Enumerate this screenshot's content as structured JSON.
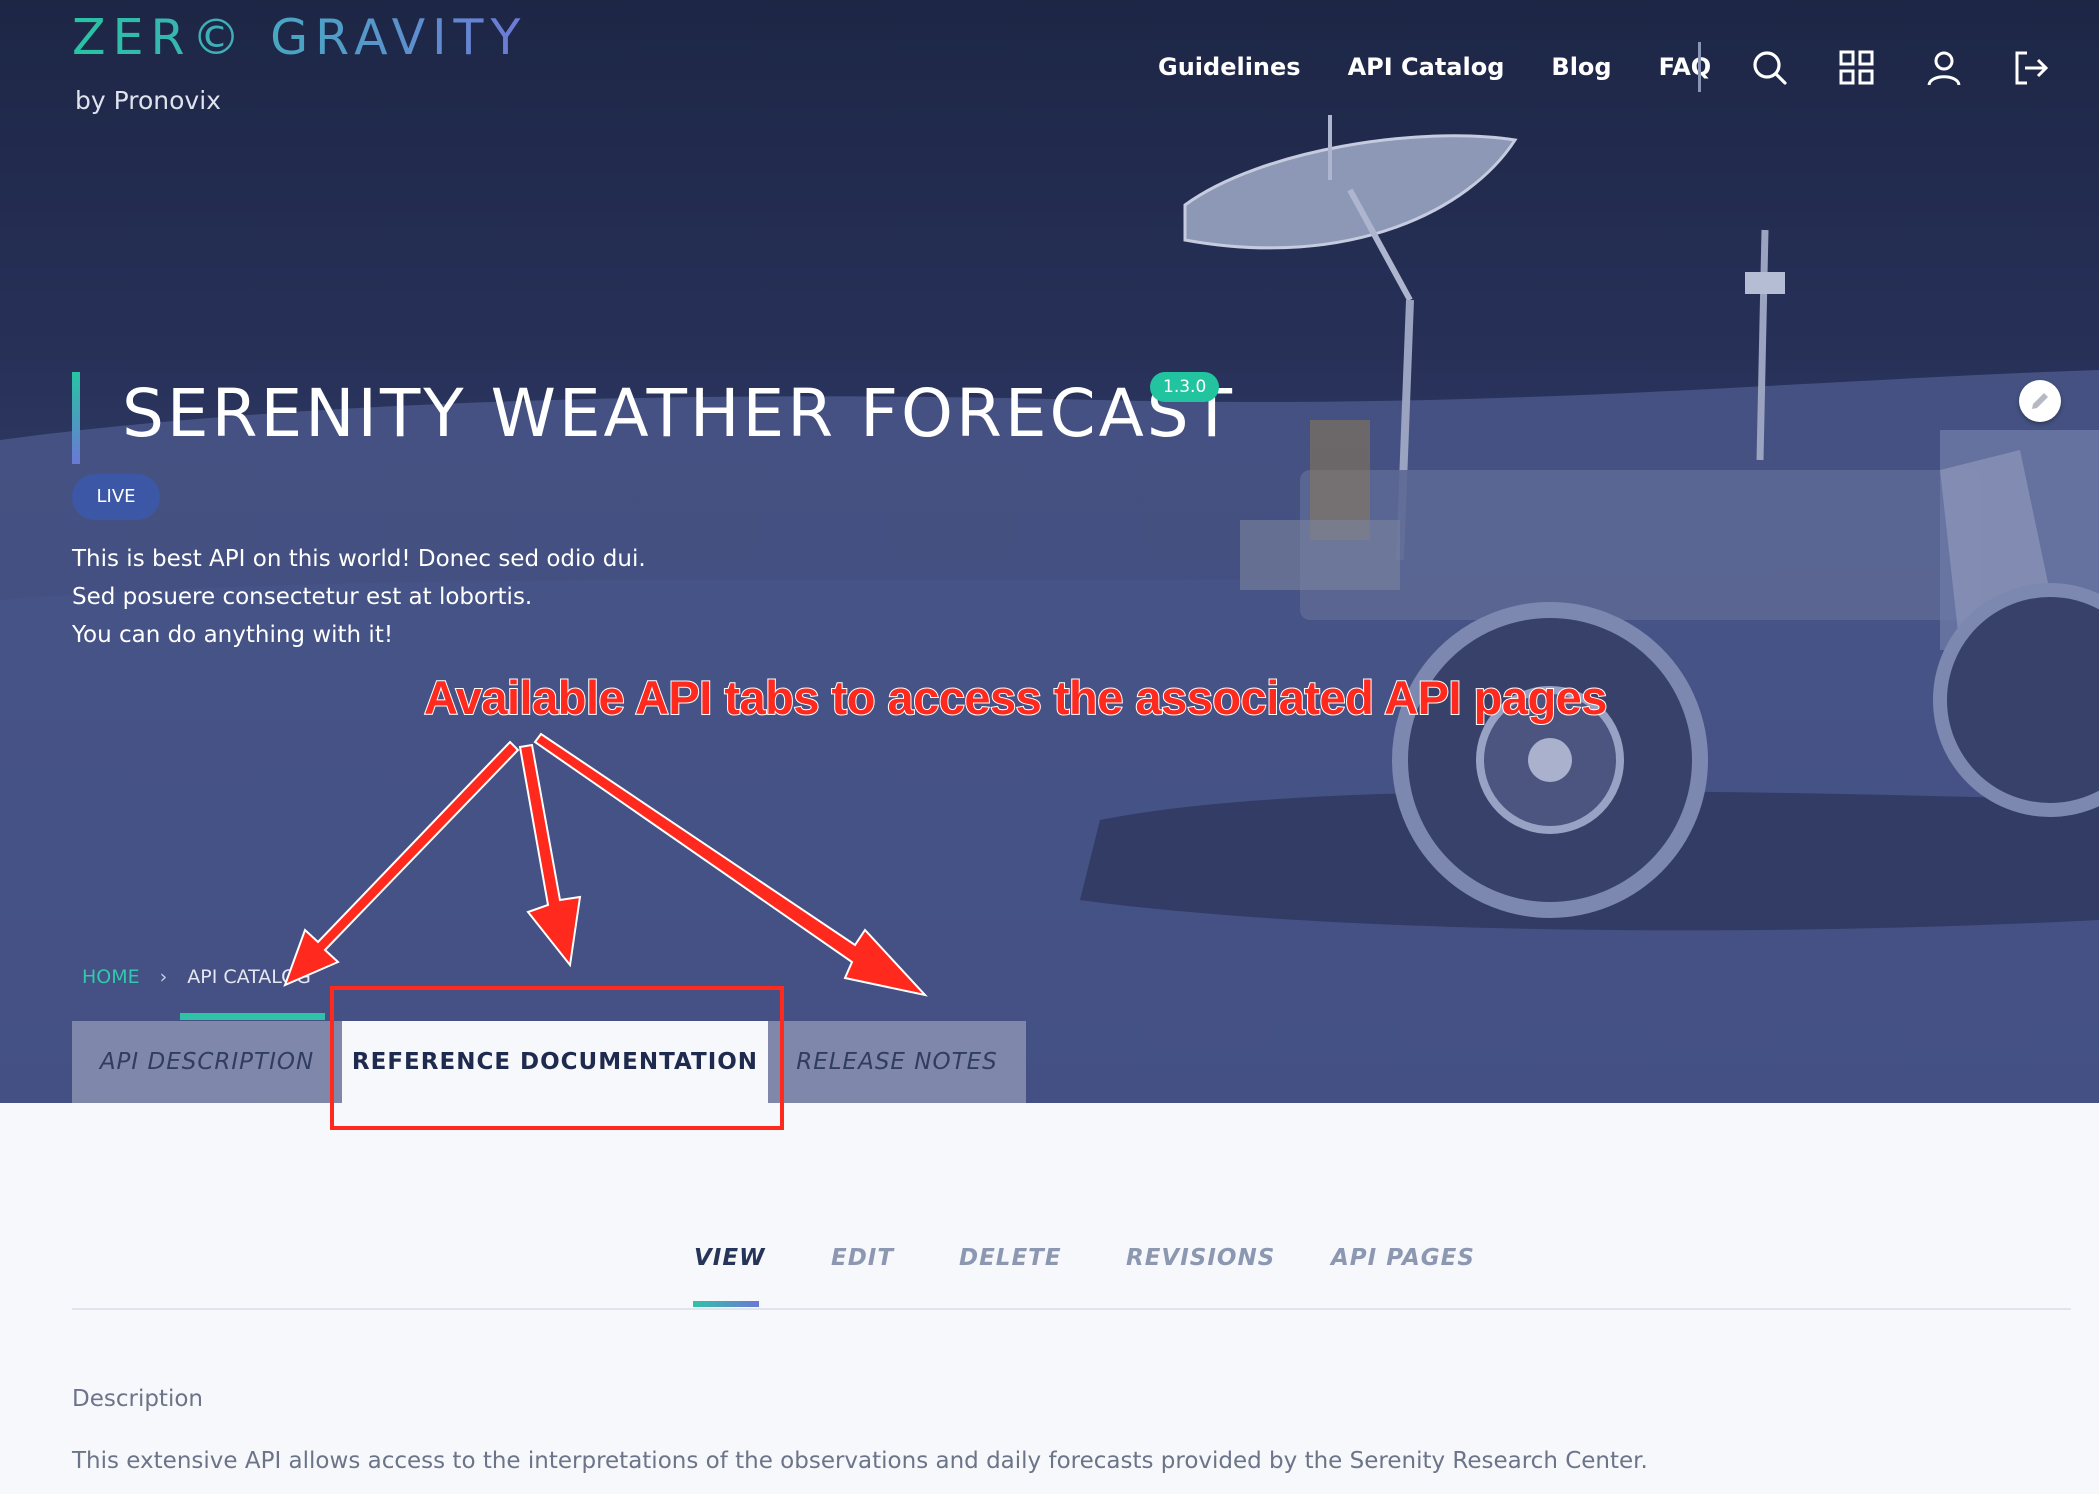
{
  "brand": {
    "logo_text": "ZER© GRAVITY",
    "byline": "by Pronovix"
  },
  "nav": {
    "links": [
      "Guidelines",
      "API Catalog",
      "Blog",
      "FAQ"
    ],
    "icons": [
      "search-icon",
      "apps-grid-icon",
      "user-icon",
      "logout-icon"
    ]
  },
  "api": {
    "title": "SERENITY WEATHER FORECAST",
    "version": "1.3.0",
    "status": "LIVE",
    "description_lines": [
      "This is best API on this world! Donec sed odio dui.",
      "Sed posuere consectetur est at lobortis.",
      "You can do anything with it!"
    ]
  },
  "breadcrumb": {
    "home": "HOME",
    "separator": "›",
    "current": "API CATALOG"
  },
  "api_tabs": {
    "description": "API DESCRIPTION",
    "reference": "REFERENCE DOCUMENTATION",
    "release_notes": "RELEASE NOTES",
    "active": "REFERENCE DOCUMENTATION"
  },
  "annotation": {
    "callout": "Available API tabs to access the associated API pages",
    "color": "#ff2a1d"
  },
  "subnav": {
    "items": [
      "VIEW",
      "EDIT",
      "DELETE",
      "REVISIONS",
      "API PAGES"
    ],
    "active": "VIEW"
  },
  "content": {
    "label": "Description",
    "body": "This extensive API allows access to the interpretations of the observations and daily forecasts provided by the Serenity Research Center."
  },
  "colors": {
    "accent_teal": "#2fc2a7",
    "accent_violet": "#6b78d6",
    "hero_navy": "#262f52",
    "live_badge": "#3c57a6"
  }
}
